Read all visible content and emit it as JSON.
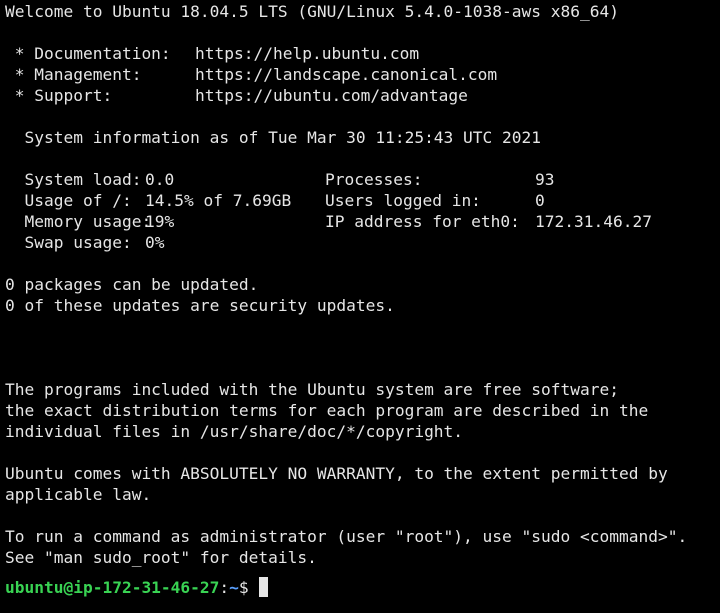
{
  "welcome": "Welcome to Ubuntu 18.04.5 LTS (GNU/Linux 5.4.0-1038-aws x86_64)",
  "links": [
    {
      "label": " * Documentation:",
      "url": "https://help.ubuntu.com"
    },
    {
      "label": " * Management:",
      "url": "https://landscape.canonical.com"
    },
    {
      "label": " * Support:",
      "url": "https://ubuntu.com/advantage"
    }
  ],
  "sysinfo_heading": "  System information as of Tue Mar 30 11:25:43 UTC 2021",
  "stats": [
    {
      "label": "  System load:",
      "value": "0.0",
      "label2": "Processes:",
      "value2": "93"
    },
    {
      "label": "  Usage of /:",
      "value": "14.5% of 7.69GB",
      "label2": "Users logged in:",
      "value2": "0"
    },
    {
      "label": "  Memory usage:",
      "value": "19%",
      "label2": "IP address for eth0:",
      "value2": "172.31.46.27"
    },
    {
      "label": "  Swap usage:",
      "value": "0%",
      "label2": "",
      "value2": ""
    }
  ],
  "updates": [
    "0 packages can be updated.",
    "0 of these updates are security updates."
  ],
  "license": [
    "The programs included with the Ubuntu system are free software;",
    "the exact distribution terms for each program are described in the",
    "individual files in /usr/share/doc/*/copyright."
  ],
  "warranty": [
    "Ubuntu comes with ABSOLUTELY NO WARRANTY, to the extent permitted by",
    "applicable law."
  ],
  "sudo_note": [
    "To run a command as administrator (user \"root\"), use \"sudo <command>\".",
    "See \"man sudo_root\" for details."
  ],
  "prompt": {
    "user_host": "ubuntu@ip-172-31-46-27",
    "colon": ":",
    "path": "~",
    "symbol": "$ "
  },
  "colors": {
    "background": "#000000",
    "text": "#e6e6e6",
    "prompt_user": "#39d353",
    "prompt_path": "#5aa0ff"
  }
}
